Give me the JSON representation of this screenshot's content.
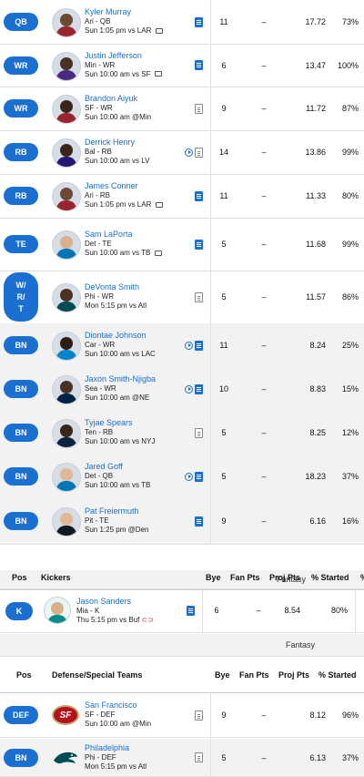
{
  "players": [
    {
      "pos": "QB",
      "name": "Kyler Murray",
      "team": "Ari - QB",
      "game": "Sun 1:05 pm vs LAR",
      "bye": "11",
      "fan": "–",
      "proj": "17.72",
      "pct": "73%",
      "note": "blue",
      "play": false,
      "cal": true,
      "bench": false
    },
    {
      "pos": "WR",
      "name": "Justin Jefferson",
      "team": "Min - WR",
      "game": "Sun 10:00 am vs SF",
      "bye": "6",
      "fan": "–",
      "proj": "13.47",
      "pct": "100%",
      "note": "blue",
      "play": false,
      "cal": true,
      "bench": false
    },
    {
      "pos": "WR",
      "name": "Brandon Aiyuk",
      "team": "SF - WR",
      "game": "Sun 10:00 am @Min",
      "bye": "9",
      "fan": "–",
      "proj": "11.72",
      "pct": "87%",
      "note": "gray",
      "play": false,
      "cal": false,
      "bench": false
    },
    {
      "pos": "RB",
      "name": "Derrick Henry",
      "team": "Bal - RB",
      "game": "Sun 10:00 am vs LV",
      "bye": "14",
      "fan": "–",
      "proj": "13.86",
      "pct": "99%",
      "note": "gray",
      "play": true,
      "cal": false,
      "bench": false
    },
    {
      "pos": "RB",
      "name": "James Conner",
      "team": "Ari - RB",
      "game": "Sun 1:05 pm vs LAR",
      "bye": "11",
      "fan": "–",
      "proj": "11.33",
      "pct": "80%",
      "note": "blue",
      "play": false,
      "cal": true,
      "bench": false
    },
    {
      "pos": "TE",
      "name": "Sam LaPorta",
      "team": "Det - TE",
      "game": "Sun 10:00 am vs TB",
      "bye": "5",
      "fan": "–",
      "proj": "11.68",
      "pct": "99%",
      "note": "blue",
      "play": false,
      "cal": true,
      "bench": false
    },
    {
      "pos": "W/R/T",
      "name": "DeVonta Smith",
      "team": "Phi - WR",
      "game": "Mon 5:15 pm vs Atl",
      "bye": "5",
      "fan": "–",
      "proj": "11.57",
      "pct": "86%",
      "note": "gray",
      "play": false,
      "cal": false,
      "bench": false
    },
    {
      "pos": "BN",
      "name": "Diontae Johnson",
      "team": "Car - WR",
      "game": "Sun 10:00 am vs LAC",
      "bye": "11",
      "fan": "–",
      "proj": "8.24",
      "pct": "25%",
      "note": "blue",
      "play": true,
      "cal": false,
      "bench": true
    },
    {
      "pos": "BN",
      "name": "Jaxon Smith-Njigba",
      "team": "Sea - WR",
      "game": "Sun 10:00 am @NE",
      "bye": "10",
      "fan": "–",
      "proj": "8.83",
      "pct": "15%",
      "note": "blue",
      "play": true,
      "cal": false,
      "bench": true
    },
    {
      "pos": "BN",
      "name": "Tyjae Spears",
      "team": "Ten - RB",
      "game": "Sun 10:00 am vs NYJ",
      "bye": "5",
      "fan": "–",
      "proj": "8.25",
      "pct": "12%",
      "note": "gray",
      "play": false,
      "cal": false,
      "bench": true
    },
    {
      "pos": "BN",
      "name": "Jared Goff",
      "team": "Det - QB",
      "game": "Sun 10:00 am vs TB",
      "bye": "5",
      "fan": "–",
      "proj": "18.23",
      "pct": "37%",
      "note": "blue",
      "play": true,
      "cal": false,
      "bench": true
    },
    {
      "pos": "BN",
      "name": "Pat Freiermuth",
      "team": "Pit - TE",
      "game": "Sun 1:25 pm @Den",
      "bye": "9",
      "fan": "–",
      "proj": "6.16",
      "pct": "16%",
      "note": "blue",
      "play": false,
      "cal": false,
      "bench": true
    }
  ],
  "kickers": {
    "group_label": "Fantasy",
    "headers": {
      "pos": "Pos",
      "section": "Kickers",
      "bye": "Bye",
      "fan": "Fan Pts",
      "proj": "Proj Pts",
      "pct": "% Started",
      "extra": "%"
    },
    "player": {
      "pos": "K",
      "name": "Jason Sanders",
      "team": "Mia - K",
      "game": "Thu 5:15 pm vs Buf",
      "bye": "6",
      "fan": "–",
      "proj": "8.54",
      "pct": "80%"
    }
  },
  "defense": {
    "group_label": "Fantasy",
    "headers": {
      "pos": "Pos",
      "section": "Defense/Special Teams",
      "bye": "Bye",
      "fan": "Fan Pts",
      "proj": "Proj Pts",
      "pct": "% Started"
    },
    "players": [
      {
        "pos": "DEF",
        "name": "San Francisco",
        "team": "SF - DEF",
        "game": "Sun 10:00 am @Min",
        "bye": "9",
        "fan": "–",
        "proj": "8.12",
        "pct": "96%",
        "bench": false,
        "logo": "niners-logo"
      },
      {
        "pos": "BN",
        "name": "Philadelphia",
        "team": "Phi - DEF",
        "game": "Mon 5:15 pm vs Atl",
        "bye": "5",
        "fan": "–",
        "proj": "6.13",
        "pct": "37%",
        "bench": true,
        "logo": "eagles-logo"
      }
    ]
  },
  "colors": {
    "accent": "#1a6fd1",
    "bench_bg": "#f2f2f2"
  }
}
